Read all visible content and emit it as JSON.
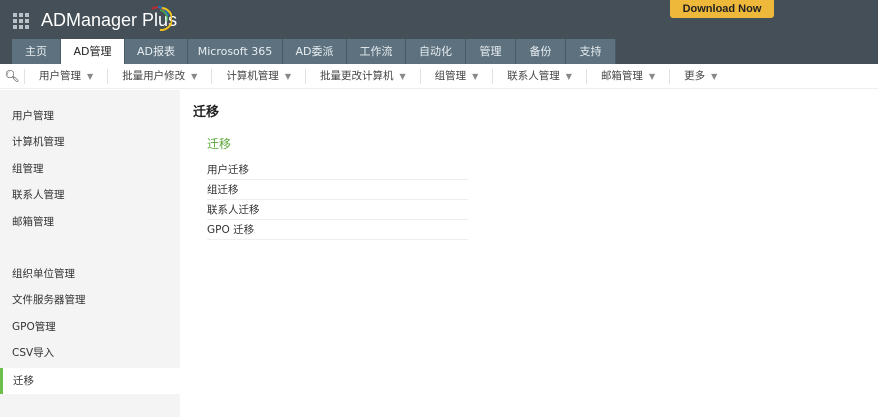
{
  "header": {
    "app_name": "ADManager Plus",
    "download_label": "Download Now"
  },
  "tabs": [
    {
      "label": "主页"
    },
    {
      "label": "AD管理"
    },
    {
      "label": "AD报表"
    },
    {
      "label": "Microsoft 365"
    },
    {
      "label": "AD委派"
    },
    {
      "label": "工作流"
    },
    {
      "label": "自动化"
    },
    {
      "label": "管理"
    },
    {
      "label": "备份"
    },
    {
      "label": "支持"
    }
  ],
  "subnav": [
    {
      "label": "用户管理"
    },
    {
      "label": "批量用户修改"
    },
    {
      "label": "计算机管理"
    },
    {
      "label": "批量更改计算机"
    },
    {
      "label": "组管理"
    },
    {
      "label": "联系人管理"
    },
    {
      "label": "邮箱管理"
    },
    {
      "label": "更多"
    }
  ],
  "sidebar": {
    "group1": [
      {
        "label": "用户管理"
      },
      {
        "label": "计算机管理"
      },
      {
        "label": "组管理"
      },
      {
        "label": "联系人管理"
      },
      {
        "label": "邮箱管理"
      }
    ],
    "group2": [
      {
        "label": "组织单位管理"
      },
      {
        "label": "文件服务器管理"
      },
      {
        "label": "GPO管理"
      },
      {
        "label": "CSV导入"
      },
      {
        "label": "迁移"
      }
    ]
  },
  "main": {
    "title": "迁移",
    "section": "迁移",
    "links": [
      {
        "label": "用户迁移"
      },
      {
        "label": "组迁移"
      },
      {
        "label": "联系人迁移"
      },
      {
        "label": "GPO 迁移"
      }
    ]
  },
  "colors": {
    "header": "#444f57",
    "tab": "#5d717e",
    "accent": "#6cbf4b",
    "download": "#eeb83b"
  }
}
